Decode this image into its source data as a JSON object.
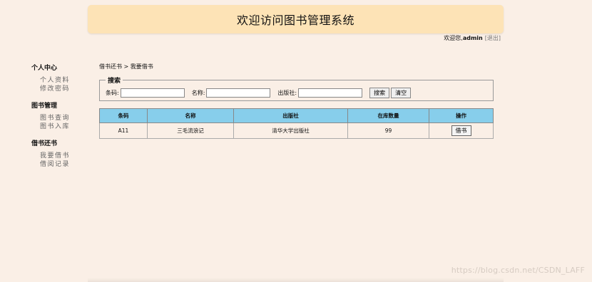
{
  "header": {
    "title": "欢迎访问图书管理系统"
  },
  "welcome": {
    "prefix": "欢迎您,",
    "username": "admin",
    "logout": "[退出]"
  },
  "sidebar": {
    "groups": [
      {
        "title": "个人中心",
        "items": [
          "个人资料",
          "修改密码"
        ]
      },
      {
        "title": "图书管理",
        "items": [
          "图书查询",
          "图书入库"
        ]
      },
      {
        "title": "借书还书",
        "items": [
          "我要借书",
          "借阅记录"
        ]
      }
    ]
  },
  "breadcrumb": "借书还书 > 我要借书",
  "search": {
    "legend": "搜索",
    "barcode_label": "条码:",
    "barcode_value": "",
    "name_label": "名称:",
    "name_value": "",
    "publisher_label": "出版社:",
    "publisher_value": "",
    "search_button": "搜索",
    "clear_button": "清空"
  },
  "table": {
    "columns": [
      "条码",
      "名称",
      "出版社",
      "在库数量",
      "操作"
    ],
    "rows": [
      {
        "barcode": "A11",
        "name": "三毛流浪记",
        "publisher": "清华大学出版社",
        "stock": "99",
        "action": "借书"
      }
    ]
  },
  "watermark": "https://blog.csdn.net/CSDN_LAFF",
  "colors": {
    "page_bg": "#faefe6",
    "header_bg": "#fde3b6",
    "table_header_bg": "#87ceeb"
  }
}
